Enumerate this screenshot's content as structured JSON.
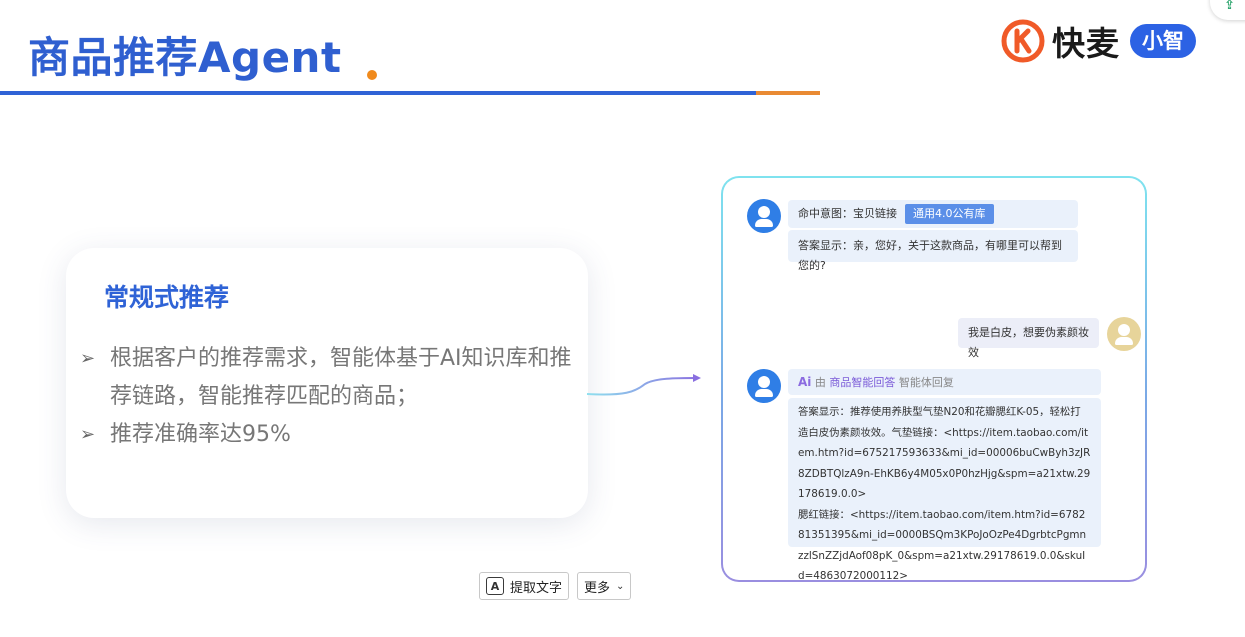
{
  "slide": {
    "title": "商品推荐Agent",
    "colors": {
      "title": "#2f5fd0",
      "accent_blue": "#2f63d6",
      "accent_orange": "#e98a33"
    }
  },
  "brand": {
    "logo_icon": "kuaimai-k-logo-icon",
    "name": "快麦",
    "badge": "小智",
    "colors": {
      "mark": "#f05a28",
      "badge": "#2c62e4"
    }
  },
  "card": {
    "heading": "常规式推荐",
    "bullets": [
      {
        "icon": "arrow-bullet-icon",
        "text": "根据客户的推荐需求，智能体基于AI知识库和推荐链路，智能推荐匹配的商品；"
      },
      {
        "icon": "arrow-bullet-icon",
        "text": "推荐准确率达95%"
      }
    ]
  },
  "chat": {
    "messages": [
      {
        "role": "bot",
        "intent_label": "命中意图：宝贝链接",
        "intent_tag": "通用4.0公有库",
        "answer": "答案显示：亲，您好，关于这款商品，有哪里可以帮到您的?"
      },
      {
        "role": "user",
        "text": "我是白皮，想要伪素颜妆效"
      },
      {
        "role": "bot",
        "ai_badge": "Ai",
        "source_prefix": "由",
        "source_link": "商品智能回答",
        "source_suffix": "智能体回复",
        "answer": "答案显示：推荐使用养肤型气垫N20和花瓣腮红K-05，轻松打造白皮伪素颜妆效。气垫链接：<https://item.taobao.com/item.htm?id=675217593633&mi_id=00006buCwByh3zJR8ZDBTQlzA9n-EhKB6y4M05x0P0hzHjg&spm=a21xtw.29178619.0.0>",
        "answer2": "腮红链接：<https://item.taobao.com/item.htm?id=678281351395&mi_id=0000BSQm3KPoJoOzPe4DgrbtcPgmnzzlSnZZjdAof08pK_0&spm=a21xtw.29178619.0.0&skuId=4863072000112>"
      }
    ]
  },
  "toolbar": {
    "extract_icon": "text-extract-icon",
    "extract_label": "提取文字",
    "more_label": "更多",
    "more_icon": "chevron-down-icon"
  },
  "corner": {
    "icon": "upload-doc-icon"
  }
}
